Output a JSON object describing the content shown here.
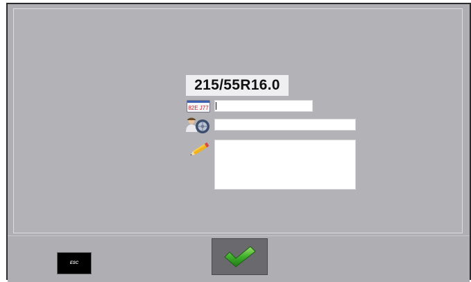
{
  "tire_size": "215/55R16.0",
  "plate_icon": {
    "icon": "license-plate-icon",
    "text": "82E J77"
  },
  "customer_icon": {
    "icon": "customer-tire-icon"
  },
  "notes_icon": {
    "icon": "pencil-icon"
  },
  "plate_field": {
    "value": "",
    "placeholder": ""
  },
  "customer_field": {
    "value": "",
    "placeholder": ""
  },
  "notes_field": {
    "value": "",
    "placeholder": ""
  },
  "buttons": {
    "esc_label": "ESC",
    "confirm_icon": "checkmark-icon"
  },
  "colors": {
    "panel": "#b3b2b6",
    "confirm_background": "#6a696d",
    "check_green": "#3fae2c"
  }
}
